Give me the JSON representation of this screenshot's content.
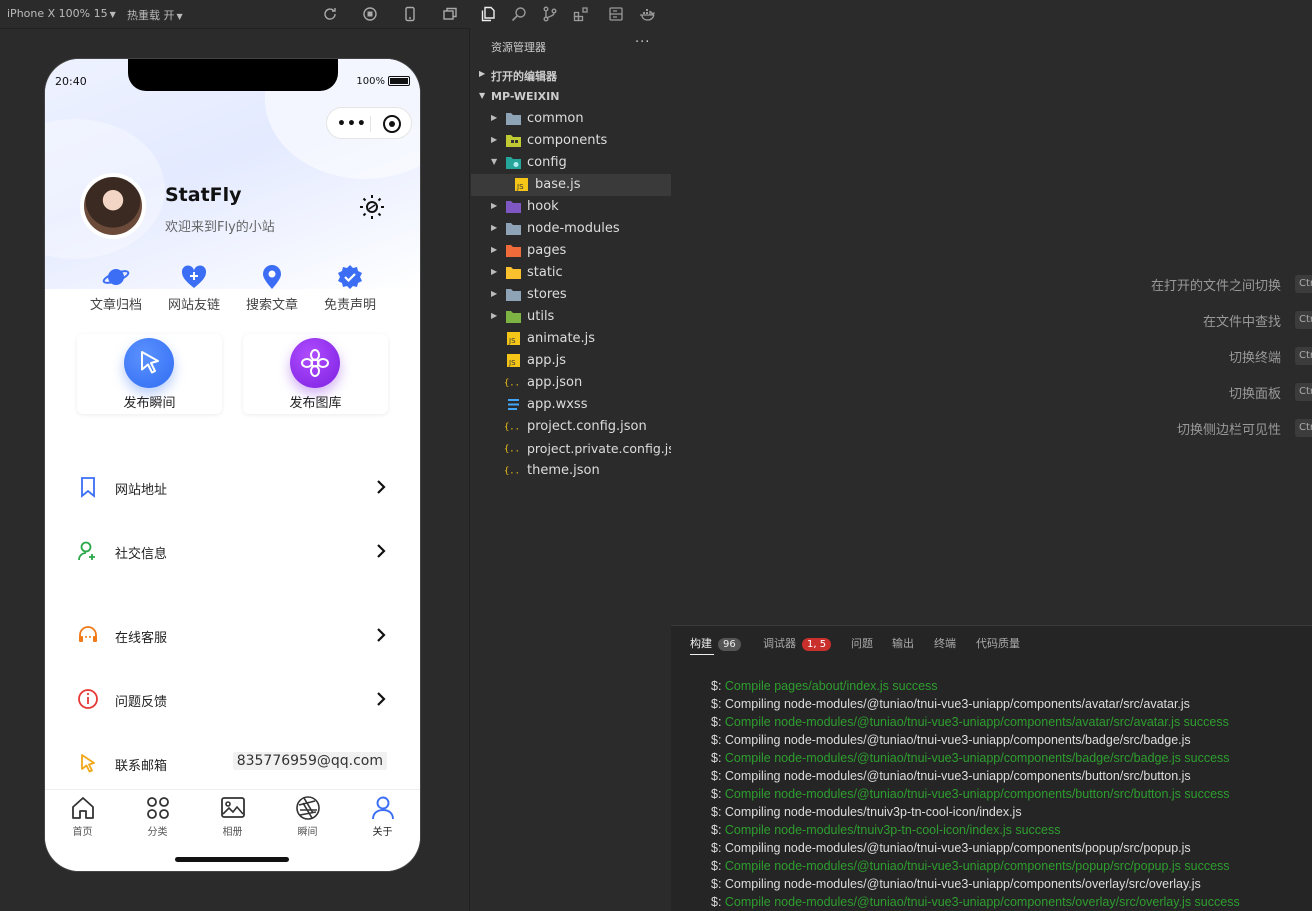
{
  "simulator": {
    "device_label": "iPhone X 100% 15",
    "hot_reload_label": "热重载 开",
    "status_time": "20:40",
    "battery_text": "100%",
    "profile": {
      "name": "StatFly",
      "subtitle": "欢迎来到Fly的小站"
    },
    "quick_actions": [
      "文章归档",
      "网站友链",
      "搜索文章",
      "免责声明"
    ],
    "publish_buttons": [
      "发布瞬间",
      "发布图库"
    ],
    "menu": [
      "网站地址",
      "社交信息",
      "在线客服",
      "问题反馈",
      "联系邮箱"
    ],
    "email": "835776959@qq.com",
    "tabs": [
      "首页",
      "分类",
      "相册",
      "瞬间",
      "关于"
    ],
    "accent_color": "#3b6ef5"
  },
  "explorer": {
    "title": "资源管理器",
    "more": "···",
    "open_editors": "打开的编辑器",
    "project": "MP-WEIXIN",
    "items": [
      {
        "name": "common",
        "kind": "folder"
      },
      {
        "name": "components",
        "kind": "folder"
      },
      {
        "name": "config",
        "kind": "folder-open"
      },
      {
        "name": "base.js",
        "kind": "js"
      },
      {
        "name": "hook",
        "kind": "folder"
      },
      {
        "name": "node-modules",
        "kind": "folder"
      },
      {
        "name": "pages",
        "kind": "folder"
      },
      {
        "name": "static",
        "kind": "folder"
      },
      {
        "name": "stores",
        "kind": "folder"
      },
      {
        "name": "utils",
        "kind": "folder"
      },
      {
        "name": "animate.js",
        "kind": "js"
      },
      {
        "name": "app.js",
        "kind": "js"
      },
      {
        "name": "app.json",
        "kind": "json"
      },
      {
        "name": "app.wxss",
        "kind": "css"
      },
      {
        "name": "project.config.json",
        "kind": "json"
      },
      {
        "name": "project.private.config.js...",
        "kind": "json"
      },
      {
        "name": "theme.json",
        "kind": "json"
      }
    ]
  },
  "editor": {
    "hints": [
      "在打开的文件之间切换",
      "在文件中查找",
      "切换终端",
      "切换面板",
      "切换侧边栏可见性"
    ],
    "kbd": "Ctrl"
  },
  "panel": {
    "tabs": {
      "build": "构建",
      "build_badge": "96",
      "debugger": "调试器",
      "debugger_badge": "1, 5",
      "problems": "问题",
      "output": "输出",
      "terminal": "终端",
      "quality": "代码质量"
    },
    "prompt": "$:",
    "lines": [
      {
        "type": "ok",
        "text": "Compile pages/about/index.js success"
      },
      {
        "type": "info",
        "text": "Compiling node-modules/@tuniao/tnui-vue3-uniapp/components/avatar/src/avatar.js"
      },
      {
        "type": "ok",
        "text": "Compile node-modules/@tuniao/tnui-vue3-uniapp/components/avatar/src/avatar.js success"
      },
      {
        "type": "info",
        "text": "Compiling node-modules/@tuniao/tnui-vue3-uniapp/components/badge/src/badge.js"
      },
      {
        "type": "ok",
        "text": "Compile node-modules/@tuniao/tnui-vue3-uniapp/components/badge/src/badge.js success"
      },
      {
        "type": "info",
        "text": "Compiling node-modules/@tuniao/tnui-vue3-uniapp/components/button/src/button.js"
      },
      {
        "type": "ok",
        "text": "Compile node-modules/@tuniao/tnui-vue3-uniapp/components/button/src/button.js success"
      },
      {
        "type": "info",
        "text": "Compiling node-modules/tnuiv3p-tn-cool-icon/index.js"
      },
      {
        "type": "ok",
        "text": "Compile node-modules/tnuiv3p-tn-cool-icon/index.js success"
      },
      {
        "type": "info",
        "text": "Compiling node-modules/@tuniao/tnui-vue3-uniapp/components/popup/src/popup.js"
      },
      {
        "type": "ok",
        "text": "Compile node-modules/@tuniao/tnui-vue3-uniapp/components/popup/src/popup.js success"
      },
      {
        "type": "info",
        "text": "Compiling node-modules/@tuniao/tnui-vue3-uniapp/components/overlay/src/overlay.js"
      },
      {
        "type": "ok",
        "text": "Compile node-modules/@tuniao/tnui-vue3-uniapp/components/overlay/src/overlay.js success"
      }
    ]
  }
}
